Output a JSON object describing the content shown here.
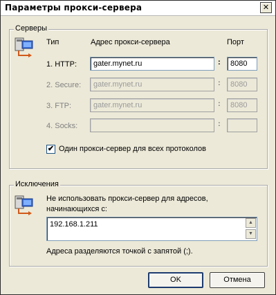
{
  "window": {
    "title": "Параметры прокси-сервера",
    "close_glyph": "✕"
  },
  "servers": {
    "group_title": "Серверы",
    "col_type": "Тип",
    "col_address": "Адрес прокси-сервера",
    "col_port": "Порт",
    "rows": [
      {
        "type_label": "1. HTTP:",
        "address": "gater.mynet.ru",
        "port": "8080",
        "enabled": true
      },
      {
        "type_label": "2. Secure:",
        "address": "gater.mynet.ru",
        "port": "8080",
        "enabled": false
      },
      {
        "type_label": "3. FTP:",
        "address": "gater.mynet.ru",
        "port": "8080",
        "enabled": false
      },
      {
        "type_label": "4. Socks:",
        "address": "",
        "port": "",
        "enabled": false
      }
    ],
    "same_proxy_checkbox": {
      "label": "Один прокси-сервер для всех протоколов",
      "checked": true,
      "glyph": "✔"
    }
  },
  "exceptions": {
    "group_title": "Исключения",
    "description": "Не использовать прокси-сервер для адресов, начинающихся с:",
    "description_line1": "Не использовать прокси-сервер для адресов,",
    "description_line2": "начинающихся с:",
    "value": "192.168.1.211",
    "hint": "Адреса разделяются точкой с запятой (;)."
  },
  "buttons": {
    "ok": "OK",
    "cancel": "Отмена"
  },
  "icons": {
    "servers": "network-computer-icon",
    "exceptions": "network-computer-icon"
  }
}
